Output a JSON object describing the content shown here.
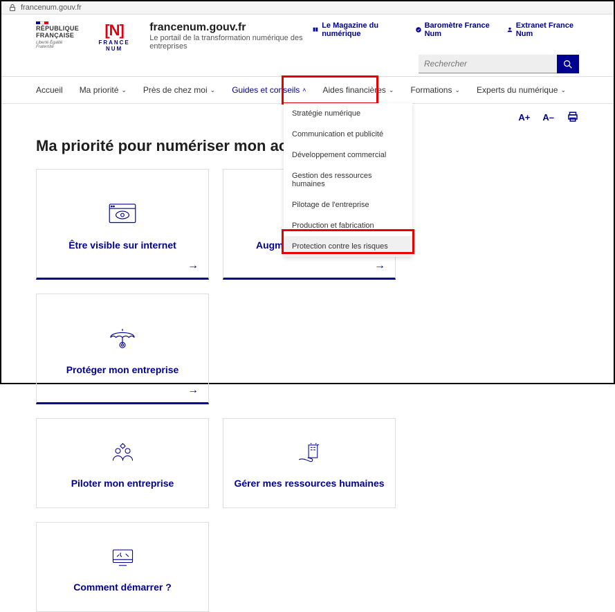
{
  "browser": {
    "url": "francenum.gouv.fr"
  },
  "header": {
    "gov_line1": "RÉPUBLIQUE",
    "gov_line2": "FRANÇAISE",
    "gov_motto": "Liberté Égalité Fraternité",
    "brand_symbol": "[N]",
    "brand_text": "FRANCE NUM",
    "site_title": "francenum.gouv.fr",
    "site_subtitle": "Le portail de la transformation numérique des entreprises",
    "top_links": [
      {
        "label": "Le Magazine du numérique"
      },
      {
        "label": "Baromètre France Num"
      },
      {
        "label": "Extranet France Num"
      }
    ],
    "search_placeholder": "Rechercher"
  },
  "nav": {
    "items": [
      {
        "label": "Accueil",
        "has_submenu": false
      },
      {
        "label": "Ma priorité",
        "has_submenu": true
      },
      {
        "label": "Près de chez moi",
        "has_submenu": true
      },
      {
        "label": "Guides et conseils",
        "has_submenu": true,
        "active": true,
        "open": true
      },
      {
        "label": "Aides financières",
        "has_submenu": true
      },
      {
        "label": "Formations",
        "has_submenu": true
      },
      {
        "label": "Experts du numérique",
        "has_submenu": true
      }
    ],
    "dropdown": [
      "Stratégie numérique",
      "Communication et publicité",
      "Développement commercial",
      "Gestion des ressources humaines",
      "Pilotage de l'entreprise",
      "Production et fabrication",
      "Protection contre les risques"
    ]
  },
  "tools": {
    "increase": "A+",
    "decrease": "A–"
  },
  "page": {
    "heading": "Ma priorité pour numériser mon activité",
    "cards": [
      "Être visible sur internet",
      "Augmenter mes ventes",
      "Protéger mon entreprise",
      "Piloter mon entreprise",
      "Gérer mes ressources humaines",
      "Comment démarrer ?"
    ]
  }
}
